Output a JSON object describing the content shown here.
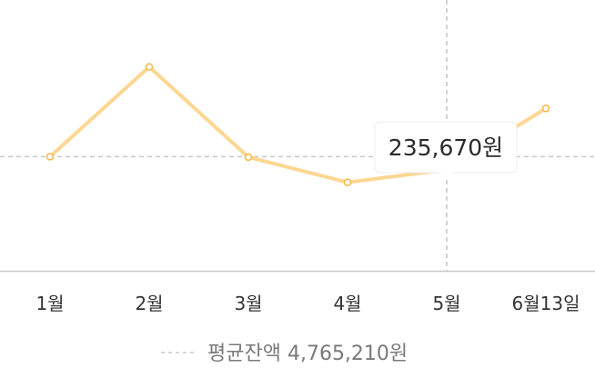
{
  "chart_data": {
    "type": "line",
    "x": [
      "1월",
      "2월",
      "3월",
      "4월",
      "5월",
      "6월13일"
    ],
    "series": [
      {
        "values": [
          4765210,
          5760000,
          4760000,
          4480000,
          4620000,
          5300000
        ],
        "color": "#fdd692"
      }
    ],
    "reference_line": {
      "label": "평균잔액 4,765,210원",
      "value": 4765210,
      "color": "#c8c8c8"
    },
    "tooltip": {
      "category": "5월",
      "text": "235,670원"
    },
    "grid": false,
    "legend": "bottom-center"
  }
}
